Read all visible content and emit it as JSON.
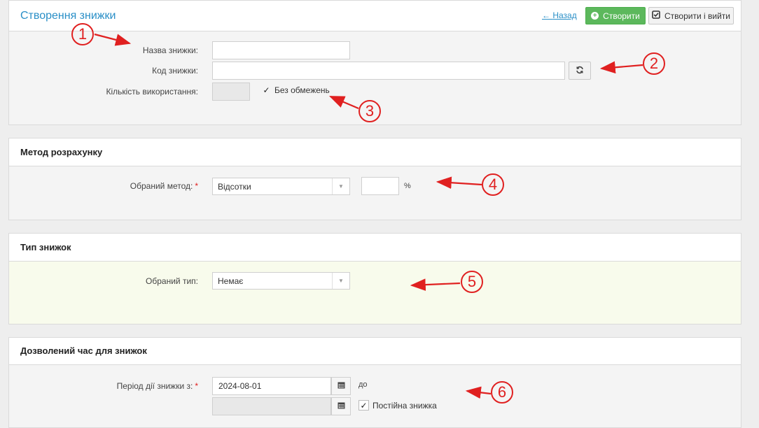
{
  "header": {
    "title": "Створення знижки",
    "back_link": "Назад",
    "back_arrow": "←",
    "create_label": "Створити",
    "create_exit_label": "Створити і вийти",
    "accent": "#2a8fc7",
    "create_color": "#5cb85c"
  },
  "general": {
    "name_label": "Назва знижки:",
    "name_value": "",
    "code_label": "Код знижки:",
    "code_value": "",
    "usage_label": "Кількість використання:",
    "usage_value": "",
    "unlimited_label": "Без обмежень",
    "unlimited_checked": true
  },
  "calc": {
    "title": "Метод розрахунку",
    "method_label": "Обраний метод:",
    "method_value": "Відсотки",
    "amount_value": "",
    "unit": "%"
  },
  "type": {
    "title": "Тип знижок",
    "type_label": "Обраний тип:",
    "type_value": "Немає"
  },
  "time": {
    "title": "Дозволений час для знижок",
    "period_label": "Період дії знижки з:",
    "from_value": "2024-08-01",
    "to_label": "до",
    "to_value": "",
    "permanent_label": "Постійна знижка",
    "permanent_checked": true
  },
  "annotations": [
    "1",
    "2",
    "3",
    "4",
    "5",
    "6"
  ]
}
